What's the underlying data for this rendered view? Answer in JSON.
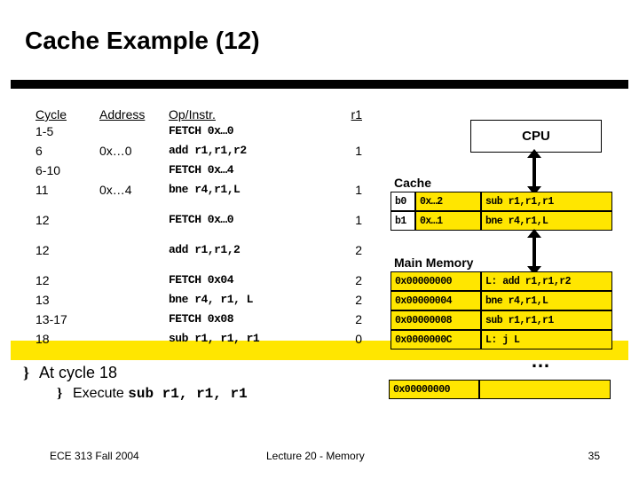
{
  "title": "Cache Example (12)",
  "trace": {
    "headers": {
      "cycle": "Cycle",
      "addr": "Address",
      "op": "Op/Instr.",
      "r1": "r1"
    },
    "rows": [
      {
        "cycle": "1-5",
        "addr": "",
        "op": "FETCH 0x…0",
        "r1": ""
      },
      {
        "cycle": "6",
        "addr": "0x…0",
        "op": "add r1,r1,r2",
        "r1": "1"
      },
      {
        "cycle": "6-10",
        "addr": "",
        "op": "FETCH 0x…4",
        "r1": ""
      },
      {
        "cycle": "11",
        "addr": "0x…4",
        "op": "bne r4,r1,L",
        "r1": "1"
      },
      {
        "cycle": "12",
        "addr": "",
        "op": "FETCH 0x…0",
        "r1": "1"
      },
      {
        "cycle": "12",
        "addr": "",
        "op": "add r1,r1,2",
        "r1": "2"
      },
      {
        "cycle": "12",
        "addr": "",
        "op": "FETCH 0x04",
        "r1": "2"
      },
      {
        "cycle": "13",
        "addr": "",
        "op": "bne r4, r1, L",
        "r1": "2"
      },
      {
        "cycle": "13-17",
        "addr": "",
        "op": "FETCH 0x08",
        "r1": "2"
      },
      {
        "cycle": "18",
        "addr": "",
        "op": "sub r1, r1, r1",
        "r1": "0"
      }
    ]
  },
  "bullets": {
    "b1": "At cycle 18",
    "b2_prefix": "Execute ",
    "b2_code": "sub r1, r1, r1"
  },
  "cpu": {
    "label": "CPU"
  },
  "cache": {
    "label": "Cache",
    "rows": [
      {
        "tag": "b0",
        "addr": "0x…2",
        "instr": "sub r1,r1,r1"
      },
      {
        "tag": "b1",
        "addr": "0x…1",
        "instr": "bne r4,r1,L"
      }
    ]
  },
  "memory": {
    "label": "Main Memory",
    "rows": [
      {
        "addr": "0x00000000",
        "instr": "L: add r1,r1,r2"
      },
      {
        "addr": "0x00000004",
        "instr": "bne r4,r1,L"
      },
      {
        "addr": "0x00000008",
        "instr": "sub r1,r1,r1"
      },
      {
        "addr": "0x0000000C",
        "instr": "L: j L"
      }
    ],
    "dots": "…",
    "data_row": {
      "addr": "0x00000000",
      "val": ""
    }
  },
  "footer": {
    "left": "ECE 313 Fall 2004",
    "mid": "Lecture 20 - Memory",
    "right": "35"
  }
}
